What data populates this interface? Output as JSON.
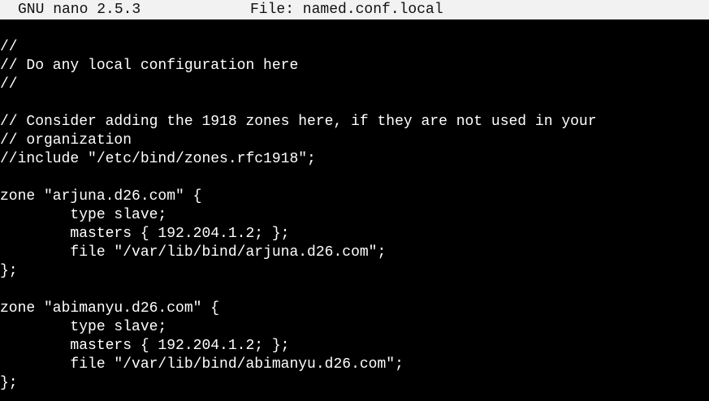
{
  "titlebar": {
    "app_name": "GNU nano 2.5.3",
    "file_label": "File: named.conf.local"
  },
  "editor": {
    "lines": [
      "//",
      "// Do any local configuration here",
      "//",
      "",
      "// Consider adding the 1918 zones here, if they are not used in your",
      "// organization",
      "//include \"/etc/bind/zones.rfc1918\";",
      "",
      "zone \"arjuna.d26.com\" {",
      "        type slave;",
      "        masters { 192.204.1.2; };",
      "        file \"/var/lib/bind/arjuna.d26.com\";",
      "};",
      "",
      "zone \"abimanyu.d26.com\" {",
      "        type slave;",
      "        masters { 192.204.1.2; };",
      "        file \"/var/lib/bind/abimanyu.d26.com\";",
      "};"
    ]
  }
}
